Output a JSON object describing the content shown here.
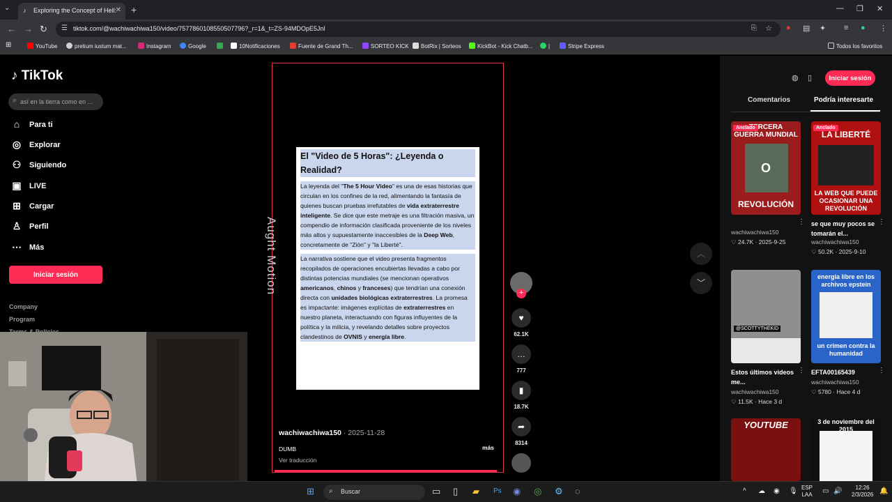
{
  "browser": {
    "tab_title": "Exploring the Concept of Hell: ",
    "url": "tiktok.com/@wachiwachiwa150/video/7577860108550507796?_r=1&_t=ZS-94MDOpE5Jnl",
    "bookmarks": [
      {
        "label": "YouTube",
        "color": "#ff0000"
      },
      {
        "label": "pretium iustum mat...",
        "color": "#cfcfcf"
      },
      {
        "label": "Instagram",
        "color": "#d62976"
      },
      {
        "label": "Google",
        "color": "#4285f4"
      },
      {
        "label": "",
        "color": "#34a853"
      },
      {
        "label": "10Notificaciones",
        "color": "#ffffff"
      },
      {
        "label": "Fuente de Grand Th...",
        "color": "#e03c31"
      },
      {
        "label": "SORTEO KICK",
        "color": "#9146ff"
      },
      {
        "label": "BotRix | Sorteos",
        "color": "#dddddd"
      },
      {
        "label": "KickBot - Kick Chatb...",
        "color": "#53fc18"
      },
      {
        "label": "|",
        "color": "#25d366"
      },
      {
        "label": "Stripe Express",
        "color": "#635bff"
      }
    ],
    "all_favorites": "Todos los favoritos"
  },
  "sidebar": {
    "logo": "TikTok",
    "search_placeholder": "así en la tierra como en ...",
    "nav": [
      {
        "label": "Para ti",
        "icon": "home-icon"
      },
      {
        "label": "Explorar",
        "icon": "compass-icon"
      },
      {
        "label": "Siguiendo",
        "icon": "following-icon"
      },
      {
        "label": "LIVE",
        "icon": "live-icon"
      },
      {
        "label": "Cargar",
        "icon": "upload-icon"
      },
      {
        "label": "Perfil",
        "icon": "profile-icon"
      },
      {
        "label": "Más",
        "icon": "more-icon"
      }
    ],
    "login": "Iniciar sesión",
    "footer": [
      "Company",
      "Program",
      "Terms & Policies"
    ]
  },
  "video": {
    "card_title": "El \"Video de 5 Horas\": ¿Leyenda o Realidad?",
    "para1": [
      {
        "t": "La leyenda del \"",
        "b": false
      },
      {
        "t": "The 5 Hour Video",
        "b": true
      },
      {
        "t": "\" es una de esas historias que circulan en los confines de la red, alimentando la fantasía de quienes buscan pruebas irrefutables de ",
        "b": false
      },
      {
        "t": "vida extraterrestre inteligente",
        "b": true
      },
      {
        "t": ". Se dice que este metraje es una filtración masiva, un compendio de información clasificada proveniente de los niveles más altos y supuestamente inaccesibles de la ",
        "b": false
      },
      {
        "t": "Deep Web",
        "b": true
      },
      {
        "t": ", concretamente de \"Zión\" y \"la Liberté\".",
        "b": false
      }
    ],
    "para2": [
      {
        "t": "La narrativa sostiene que el video presenta fragmentos recopilados de operaciones encubiertas llevadas a cabo por distintas potencias mundiales (se mencionan operativos ",
        "b": false
      },
      {
        "t": "americanos",
        "b": true
      },
      {
        "t": ", ",
        "b": false
      },
      {
        "t": "chinos",
        "b": true
      },
      {
        "t": " y ",
        "b": false
      },
      {
        "t": "franceses",
        "b": true
      },
      {
        "t": ") que tendrían una conexión directa con ",
        "b": false
      },
      {
        "t": "unidades biológicas extraterrestres",
        "b": true
      },
      {
        "t": ". La promesa es impactante: imágenes explícitas de ",
        "b": false
      },
      {
        "t": "extraterrestres",
        "b": true
      },
      {
        "t": " en nuestro planeta, interactuando con figuras influyentes de la política y la milicia, y revelando detalles sobre proyectos clandestinos de ",
        "b": false
      },
      {
        "t": "OVNIS",
        "b": true
      },
      {
        "t": " y ",
        "b": false
      },
      {
        "t": "energía libre",
        "b": true
      },
      {
        "t": ".",
        "b": false
      }
    ],
    "watermark": "Aught Motion",
    "author": "wachiwachiwa150",
    "date": "· 2025-11-28",
    "caption": "DUMB",
    "translate": "Ver traducción",
    "more": "más",
    "progress_fraction": 0.98
  },
  "actions": {
    "likes": "62.1K",
    "comments": "777",
    "saves": "18.7K",
    "shares": "8314"
  },
  "right_panel": {
    "login": "Iniciar sesión",
    "tab_comments": "Comentarios",
    "tab_suggested": "Podría interesarte",
    "cards": [
      {
        "pinned": "Anclado",
        "thumb_top": "TERCERA GUERRA MUNDIAL",
        "thumb_mid": "O",
        "thumb_bottom": "REVOLUCIÓN",
        "title": "",
        "user": "wachiwachiwa150",
        "stats": "♡ 24.7K · 2025-9-25",
        "bg": "#9b1c1c"
      },
      {
        "pinned": "Anclado",
        "thumb_top": "LA LIBERTÉ",
        "thumb_mid": "",
        "thumb_bottom": "LA WEB QUE PUEDE OCASIONAR UNA REVOLUCIÓN",
        "title": "se que muy pocos se tomarán el...",
        "user": "wachiwachiwa150",
        "stats": "♡ 50.2K · 2025-9-10",
        "bg": "#b01010"
      },
      {
        "pinned": "",
        "thumb_top": "",
        "thumb_mid": "@SCOTTYTHEKID",
        "thumb_bottom": "",
        "title": "Estos últimos videos me...",
        "user": "wachiwachiwa150",
        "stats": "♡ 11.5K · Hace 3 d",
        "bg": "#8f8f8f"
      },
      {
        "pinned": "",
        "thumb_top": "energía libre en los archivos epstein",
        "thumb_mid": "",
        "thumb_bottom": "un crimen contra la humanidad",
        "title": "EFTA00165439",
        "user": "wachiwachiwa150",
        "stats": "♡ 5780 · Hace 4 d",
        "bg": "#2a64c8"
      },
      {
        "pinned": "",
        "thumb_top": "YOUTUBE",
        "thumb_mid": "",
        "thumb_bottom": "",
        "title": "",
        "user": "",
        "stats": "",
        "bg": "#7a1010"
      },
      {
        "pinned": "",
        "thumb_top": "3 de noviembre del 2015",
        "thumb_mid": "",
        "thumb_bottom": "",
        "title": "",
        "user": "",
        "stats": "",
        "bg": "#101010"
      }
    ]
  },
  "taskbar": {
    "search": "Buscar",
    "lang_top": "ESP",
    "lang_bottom": "LAA",
    "time": "12:26",
    "date": "2/3/2026"
  }
}
